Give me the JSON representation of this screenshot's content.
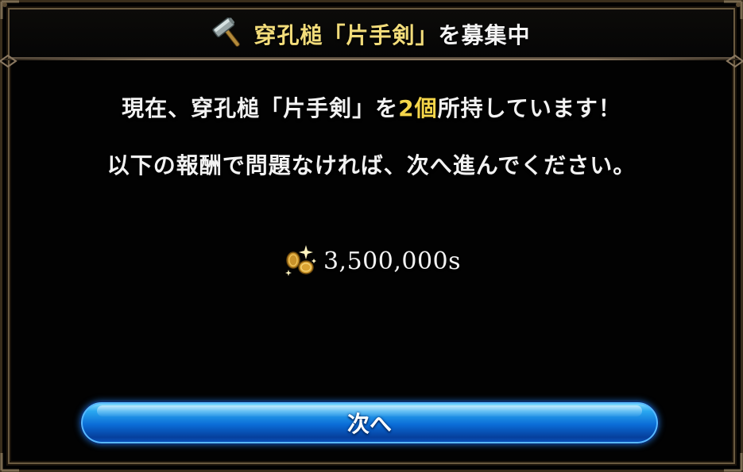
{
  "dialog": {
    "title_item": "穿孔槌「片手剣」",
    "title_suffix": "を募集中",
    "message_line1_prefix": "現在、穿孔槌「片手剣」を",
    "message_line1_count": "2個",
    "message_line1_suffix": "所持しています！",
    "message_line2": "以下の報酬で問題なければ、次へ進んでください。",
    "reward_amount": "3,500,000s",
    "next_button_label": "次へ"
  },
  "icons": {
    "title_icon": "hammer-icon",
    "reward_icon": "gold-coins-icon"
  },
  "colors": {
    "title_gold": "#f2dc7a",
    "count_yellow": "#f5d64a",
    "button_blue": "#0a6bd6"
  }
}
